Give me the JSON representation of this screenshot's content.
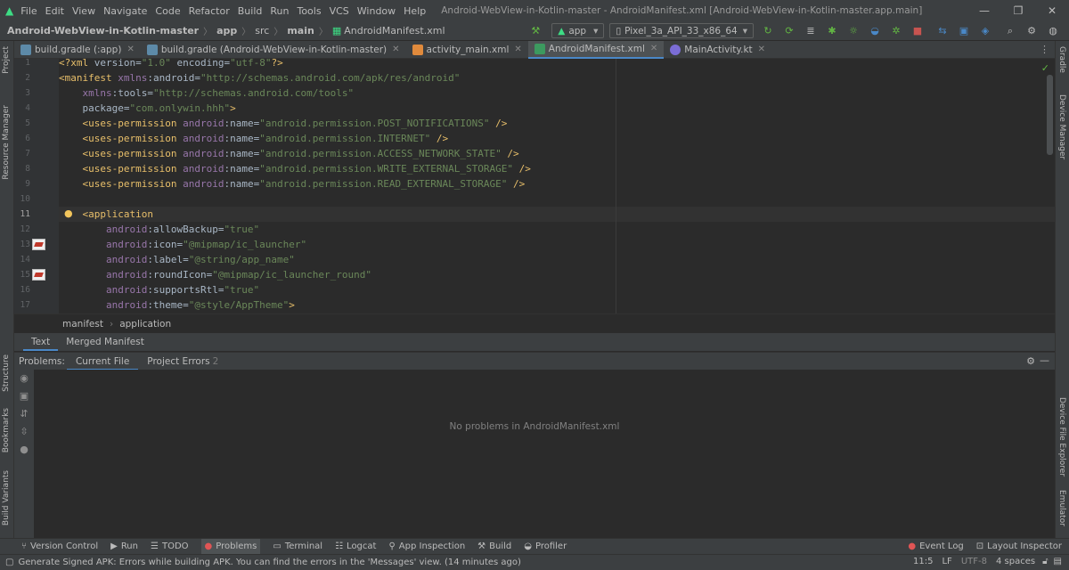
{
  "window": {
    "menu": [
      "File",
      "Edit",
      "View",
      "Navigate",
      "Code",
      "Refactor",
      "Build",
      "Run",
      "Tools",
      "VCS",
      "Window",
      "Help"
    ],
    "title": "Android-WebView-in-Kotlin-master - AndroidManifest.xml [Android-WebView-in-Kotlin-master.app.main]"
  },
  "navbar": {
    "crumbs": [
      "Android-WebView-in-Kotlin-master",
      "app",
      "src",
      "main",
      "AndroidManifest.xml"
    ],
    "run_config": "app",
    "device": "Pixel_3a_API_33_x86_64"
  },
  "tabs": [
    {
      "label": "build.gradle (:app)"
    },
    {
      "label": "build.gradle (Android-WebView-in-Kotlin-master)"
    },
    {
      "label": "activity_main.xml"
    },
    {
      "label": "AndroidManifest.xml"
    },
    {
      "label": "MainActivity.kt"
    }
  ],
  "side_left": [
    "Project",
    "Resource Manager",
    "Structure",
    "Bookmarks",
    "Build Variants"
  ],
  "side_right": [
    "Gradle",
    "Device Manager",
    "Device File Explorer",
    "Emulator"
  ],
  "code_lines": [
    {
      "n": "1",
      "text": "<?xml version=\"1.0\" encoding=\"utf-8\"?>"
    },
    {
      "n": "2",
      "text": "<manifest xmlns:android=\"http://schemas.android.com/apk/res/android\""
    },
    {
      "n": "3",
      "text": "    xmlns:tools=\"http://schemas.android.com/tools\""
    },
    {
      "n": "4",
      "text": "    package=\"com.onlywin.hhh\">"
    },
    {
      "n": "5",
      "text": "    <uses-permission android:name=\"android.permission.POST_NOTIFICATIONS\" />"
    },
    {
      "n": "6",
      "text": "    <uses-permission android:name=\"android.permission.INTERNET\" />"
    },
    {
      "n": "7",
      "text": "    <uses-permission android:name=\"android.permission.ACCESS_NETWORK_STATE\" />"
    },
    {
      "n": "8",
      "text": "    <uses-permission android:name=\"android.permission.WRITE_EXTERNAL_STORAGE\" />"
    },
    {
      "n": "9",
      "text": "    <uses-permission android:name=\"android.permission.READ_EXTERNAL_STORAGE\" />"
    },
    {
      "n": "10",
      "text": ""
    },
    {
      "n": "11",
      "text": "    <application"
    },
    {
      "n": "12",
      "text": "        android:allowBackup=\"true\""
    },
    {
      "n": "13",
      "text": "        android:icon=\"@mipmap/ic_launcher\""
    },
    {
      "n": "14",
      "text": "        android:label=\"@string/app_name\""
    },
    {
      "n": "15",
      "text": "        android:roundIcon=\"@mipmap/ic_launcher_round\""
    },
    {
      "n": "16",
      "text": "        android:supportsRtl=\"true\""
    },
    {
      "n": "17",
      "text": "        android:theme=\"@style/AppTheme\">"
    }
  ],
  "editor_breadcrumb": [
    "manifest",
    "application"
  ],
  "view_tabs": [
    "Text",
    "Merged Manifest"
  ],
  "problems": {
    "label": "Problems:",
    "tabs": [
      {
        "label": "Current File"
      },
      {
        "label": "Project Errors",
        "count": "2"
      }
    ],
    "empty_text": "No problems in AndroidManifest.xml"
  },
  "tool_windows": [
    "Version Control",
    "Run",
    "TODO",
    "Problems",
    "Terminal",
    "Logcat",
    "App Inspection",
    "Build",
    "Profiler"
  ],
  "tool_windows_right": [
    "Event Log",
    "Layout Inspector"
  ],
  "status": {
    "message": "Generate Signed APK: Errors while building APK. You can find the errors in the 'Messages' view. (14 minutes ago)",
    "position": "11:5",
    "line_sep": "LF",
    "encoding": "UTF-8",
    "indent": "4 spaces"
  },
  "colors": {
    "accent": "#4a88c7",
    "tag": "#e8bf6a",
    "string": "#6a8759",
    "namespace": "#9876aa"
  }
}
